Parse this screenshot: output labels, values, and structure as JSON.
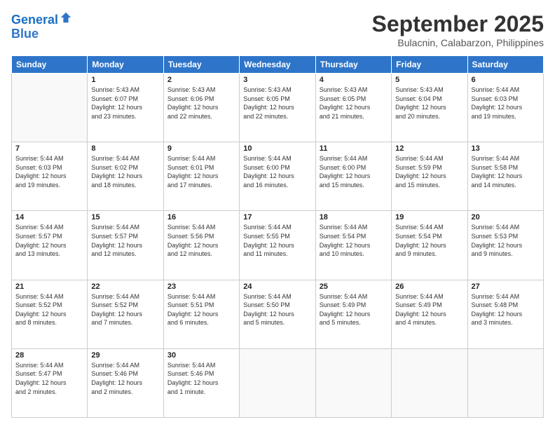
{
  "header": {
    "logo_line1": "General",
    "logo_line2": "Blue",
    "title": "September 2025",
    "location": "Bulacnin, Calabarzon, Philippines"
  },
  "weekdays": [
    "Sunday",
    "Monday",
    "Tuesday",
    "Wednesday",
    "Thursday",
    "Friday",
    "Saturday"
  ],
  "weeks": [
    [
      {
        "day": "",
        "info": ""
      },
      {
        "day": "1",
        "info": "Sunrise: 5:43 AM\nSunset: 6:07 PM\nDaylight: 12 hours\nand 23 minutes."
      },
      {
        "day": "2",
        "info": "Sunrise: 5:43 AM\nSunset: 6:06 PM\nDaylight: 12 hours\nand 22 minutes."
      },
      {
        "day": "3",
        "info": "Sunrise: 5:43 AM\nSunset: 6:05 PM\nDaylight: 12 hours\nand 22 minutes."
      },
      {
        "day": "4",
        "info": "Sunrise: 5:43 AM\nSunset: 6:05 PM\nDaylight: 12 hours\nand 21 minutes."
      },
      {
        "day": "5",
        "info": "Sunrise: 5:43 AM\nSunset: 6:04 PM\nDaylight: 12 hours\nand 20 minutes."
      },
      {
        "day": "6",
        "info": "Sunrise: 5:44 AM\nSunset: 6:03 PM\nDaylight: 12 hours\nand 19 minutes."
      }
    ],
    [
      {
        "day": "7",
        "info": "Sunrise: 5:44 AM\nSunset: 6:03 PM\nDaylight: 12 hours\nand 19 minutes."
      },
      {
        "day": "8",
        "info": "Sunrise: 5:44 AM\nSunset: 6:02 PM\nDaylight: 12 hours\nand 18 minutes."
      },
      {
        "day": "9",
        "info": "Sunrise: 5:44 AM\nSunset: 6:01 PM\nDaylight: 12 hours\nand 17 minutes."
      },
      {
        "day": "10",
        "info": "Sunrise: 5:44 AM\nSunset: 6:00 PM\nDaylight: 12 hours\nand 16 minutes."
      },
      {
        "day": "11",
        "info": "Sunrise: 5:44 AM\nSunset: 6:00 PM\nDaylight: 12 hours\nand 15 minutes."
      },
      {
        "day": "12",
        "info": "Sunrise: 5:44 AM\nSunset: 5:59 PM\nDaylight: 12 hours\nand 15 minutes."
      },
      {
        "day": "13",
        "info": "Sunrise: 5:44 AM\nSunset: 5:58 PM\nDaylight: 12 hours\nand 14 minutes."
      }
    ],
    [
      {
        "day": "14",
        "info": "Sunrise: 5:44 AM\nSunset: 5:57 PM\nDaylight: 12 hours\nand 13 minutes."
      },
      {
        "day": "15",
        "info": "Sunrise: 5:44 AM\nSunset: 5:57 PM\nDaylight: 12 hours\nand 12 minutes."
      },
      {
        "day": "16",
        "info": "Sunrise: 5:44 AM\nSunset: 5:56 PM\nDaylight: 12 hours\nand 12 minutes."
      },
      {
        "day": "17",
        "info": "Sunrise: 5:44 AM\nSunset: 5:55 PM\nDaylight: 12 hours\nand 11 minutes."
      },
      {
        "day": "18",
        "info": "Sunrise: 5:44 AM\nSunset: 5:54 PM\nDaylight: 12 hours\nand 10 minutes."
      },
      {
        "day": "19",
        "info": "Sunrise: 5:44 AM\nSunset: 5:54 PM\nDaylight: 12 hours\nand 9 minutes."
      },
      {
        "day": "20",
        "info": "Sunrise: 5:44 AM\nSunset: 5:53 PM\nDaylight: 12 hours\nand 9 minutes."
      }
    ],
    [
      {
        "day": "21",
        "info": "Sunrise: 5:44 AM\nSunset: 5:52 PM\nDaylight: 12 hours\nand 8 minutes."
      },
      {
        "day": "22",
        "info": "Sunrise: 5:44 AM\nSunset: 5:52 PM\nDaylight: 12 hours\nand 7 minutes."
      },
      {
        "day": "23",
        "info": "Sunrise: 5:44 AM\nSunset: 5:51 PM\nDaylight: 12 hours\nand 6 minutes."
      },
      {
        "day": "24",
        "info": "Sunrise: 5:44 AM\nSunset: 5:50 PM\nDaylight: 12 hours\nand 5 minutes."
      },
      {
        "day": "25",
        "info": "Sunrise: 5:44 AM\nSunset: 5:49 PM\nDaylight: 12 hours\nand 5 minutes."
      },
      {
        "day": "26",
        "info": "Sunrise: 5:44 AM\nSunset: 5:49 PM\nDaylight: 12 hours\nand 4 minutes."
      },
      {
        "day": "27",
        "info": "Sunrise: 5:44 AM\nSunset: 5:48 PM\nDaylight: 12 hours\nand 3 minutes."
      }
    ],
    [
      {
        "day": "28",
        "info": "Sunrise: 5:44 AM\nSunset: 5:47 PM\nDaylight: 12 hours\nand 2 minutes."
      },
      {
        "day": "29",
        "info": "Sunrise: 5:44 AM\nSunset: 5:46 PM\nDaylight: 12 hours\nand 2 minutes."
      },
      {
        "day": "30",
        "info": "Sunrise: 5:44 AM\nSunset: 5:46 PM\nDaylight: 12 hours\nand 1 minute."
      },
      {
        "day": "",
        "info": ""
      },
      {
        "day": "",
        "info": ""
      },
      {
        "day": "",
        "info": ""
      },
      {
        "day": "",
        "info": ""
      }
    ]
  ]
}
